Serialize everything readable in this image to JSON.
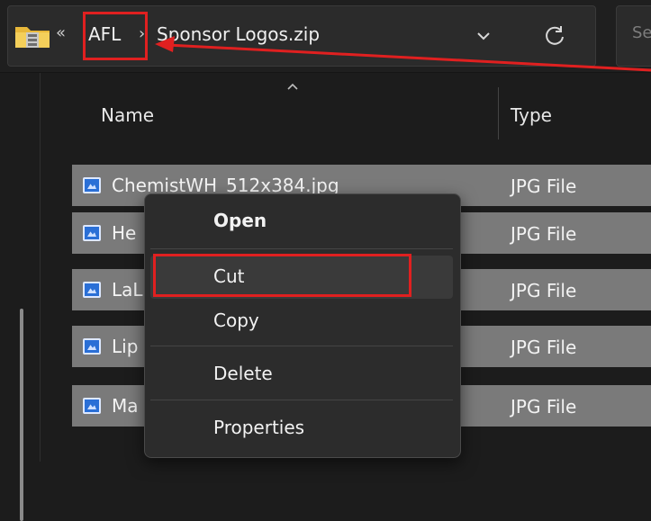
{
  "address_bar": {
    "lead_separator": "«",
    "crumbs": [
      "AFL",
      "Sponsor Logos.zip"
    ],
    "separator": "›",
    "search_placeholder": "Se"
  },
  "columns": {
    "name": "Name",
    "type": "Type"
  },
  "files": [
    {
      "name": "ChemistWH_512x384.jpg",
      "type": "JPG File"
    },
    {
      "name": "He",
      "type": "JPG File"
    },
    {
      "name": "LaL",
      "type": "JPG File"
    },
    {
      "name": "Lip",
      "type": "JPG File"
    },
    {
      "name": "Ma",
      "type": "JPG File"
    }
  ],
  "context_menu": {
    "open": "Open",
    "cut": "Cut",
    "copy": "Copy",
    "delete": "Delete",
    "properties": "Properties"
  },
  "colors": {
    "highlight": "#e02020",
    "row_selected": "#7a7a7a",
    "menu_bg": "#2c2c2c",
    "folder_icon": "#e8b83a"
  }
}
